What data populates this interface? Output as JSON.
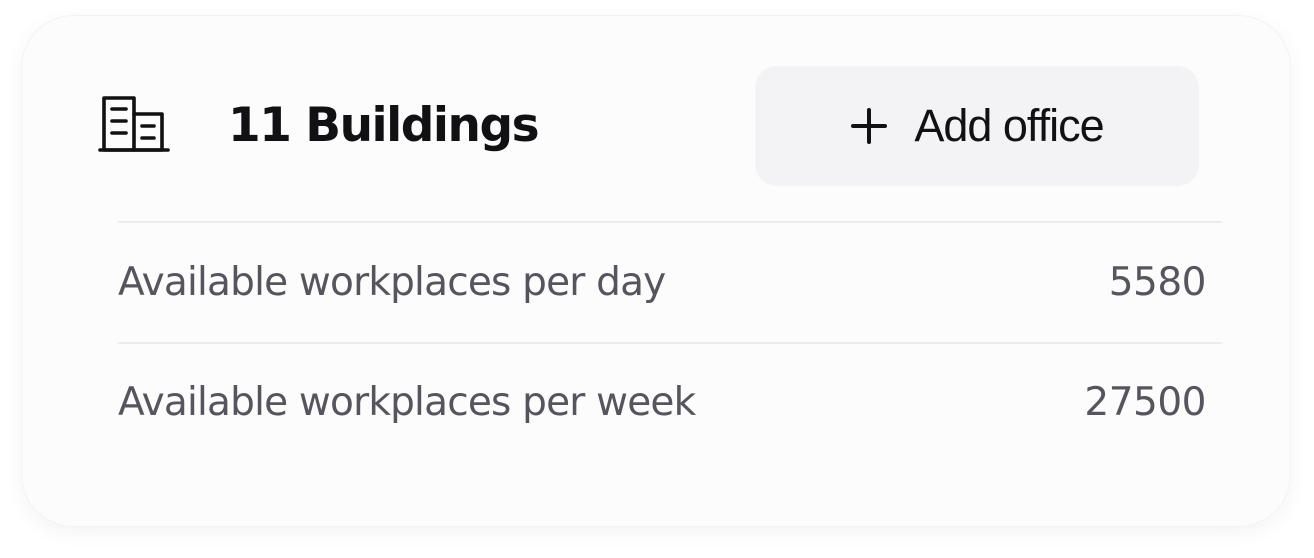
{
  "header": {
    "icon": "building-icon",
    "title": "11 Buildings",
    "add_button": {
      "icon": "plus-icon",
      "label": "Add office"
    }
  },
  "stats": [
    {
      "label": "Available workplaces per day",
      "value": "5580"
    },
    {
      "label": "Available workplaces per week",
      "value": "27500"
    }
  ],
  "colors": {
    "card_background": "#fcfcfd",
    "button_background": "#f3f2f5",
    "title_text": "#111114",
    "secondary_text": "#55555d",
    "divider": "#ececef"
  }
}
